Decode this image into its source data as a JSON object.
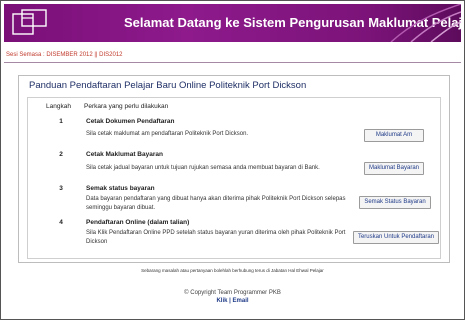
{
  "header": {
    "title": "Selamat Datang ke Sistem Pengurusan Maklumat Pelajar (SIMS)",
    "logo_icon": "logo-icon",
    "colors": {
      "banner": "#7a0f78",
      "title_text": "#ffffff",
      "accent": "#c0392b"
    }
  },
  "session": {
    "text": "Sesi Semasa : DISEMBER 2012 || DIS2012"
  },
  "page": {
    "title": "Panduan Pendaftaran Pelajar Baru Online Politeknik Port Dickson",
    "col_step": "Langkah",
    "col_action": "Perkara yang perlu dilakukan"
  },
  "steps": [
    {
      "no": "1",
      "title": "Cetak Dokumen Pendaftaran",
      "desc": "Sila cetak maklumat am pendaftaran Politeknik Port Dickson.",
      "button": "Maklumat Am"
    },
    {
      "no": "2",
      "title": "Cetak Maklumat Bayaran",
      "desc": "Sila cetak jadual bayaran untuk tujuan rujukan semasa anda membuat bayaran di Bank.",
      "button": "Maklumat Bayaran"
    },
    {
      "no": "3",
      "title": "Semak status bayaran",
      "desc": "Data bayaran pendaftaran yang dibuat hanya akan diterima pihak Politeknik Port Dickson selepas seminggu bayaran dibuat.",
      "button": "Semak Status Bayaran"
    },
    {
      "no": "4",
      "title": "Pendaftaran Online (dalam talian)",
      "desc": "Sila Klik Pendaftaran Online PPD setelah status bayaran yuran diterima oleh pihak Politeknik Port Dickson",
      "button": "Teruskan Untuk Pendaftaran"
    }
  ],
  "footer": {
    "note": "Sebarang masalah atau pertanyaan bolehlah berhubung terus di Jabatan Hal Ehwal Pelajar",
    "copyright": "© Copyright Team Programmer PKB",
    "link_klik": "Klik",
    "separator": "|",
    "link_email": "Email"
  }
}
